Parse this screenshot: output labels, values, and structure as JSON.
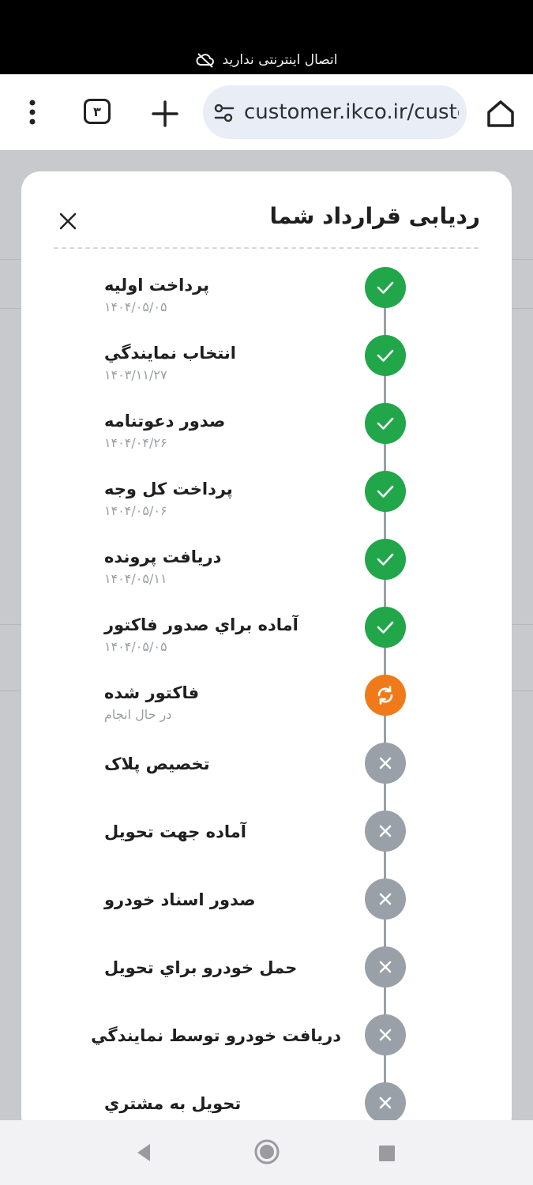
{
  "status_bar": {
    "text": "اتصال اینترنتی ندارید",
    "icon": "cloud-off-icon"
  },
  "browser": {
    "url": "customer.ikco.ir/custo",
    "tab_count": "۳",
    "icons": [
      "home-icon",
      "site-settings-icon",
      "plus-icon",
      "more-vert-icon"
    ]
  },
  "modal": {
    "title": "ردیابی قرارداد شما",
    "close_icon": "close-icon",
    "steps": [
      {
        "title": "پرداخت اولیه",
        "sub": "۱۴۰۴/۰۵/۰۵",
        "status": "done"
      },
      {
        "title": "انتخاب نمايندگي",
        "sub": "۱۴۰۳/۱۱/۲۷",
        "status": "done"
      },
      {
        "title": "صدور دعوتنامه",
        "sub": "۱۴۰۴/۰۴/۲۶",
        "status": "done"
      },
      {
        "title": "پرداخت کل وجه",
        "sub": "۱۴۰۴/۰۵/۰۶",
        "status": "done"
      },
      {
        "title": "دریافت پرونده",
        "sub": "۱۴۰۴/۰۵/۱۱",
        "status": "done"
      },
      {
        "title": "آماده براي صدور فاکتور",
        "sub": "۱۴۰۴/۰۵/۰۵",
        "status": "done"
      },
      {
        "title": "فاکتور شده",
        "sub": "در حال انجام",
        "status": "in_progress"
      },
      {
        "title": "تخصیص پلاک",
        "sub": "",
        "status": "pending"
      },
      {
        "title": "آماده جهت تحويل",
        "sub": "",
        "status": "pending"
      },
      {
        "title": "صدور اسناد خودرو",
        "sub": "",
        "status": "pending"
      },
      {
        "title": "حمل خودرو براي تحويل",
        "sub": "",
        "status": "pending"
      },
      {
        "title": "دریافت خودرو توسط نمايندگي",
        "sub": "",
        "status": "pending"
      },
      {
        "title": "تحويل به مشتري",
        "sub": "",
        "status": "pending"
      }
    ]
  },
  "colors": {
    "done": "#22a64a",
    "in_progress": "#f07a1a",
    "pending": "#9aa0a8"
  },
  "nav_bar": {
    "icons": [
      "back-icon",
      "home-circle-icon",
      "recents-icon"
    ]
  }
}
